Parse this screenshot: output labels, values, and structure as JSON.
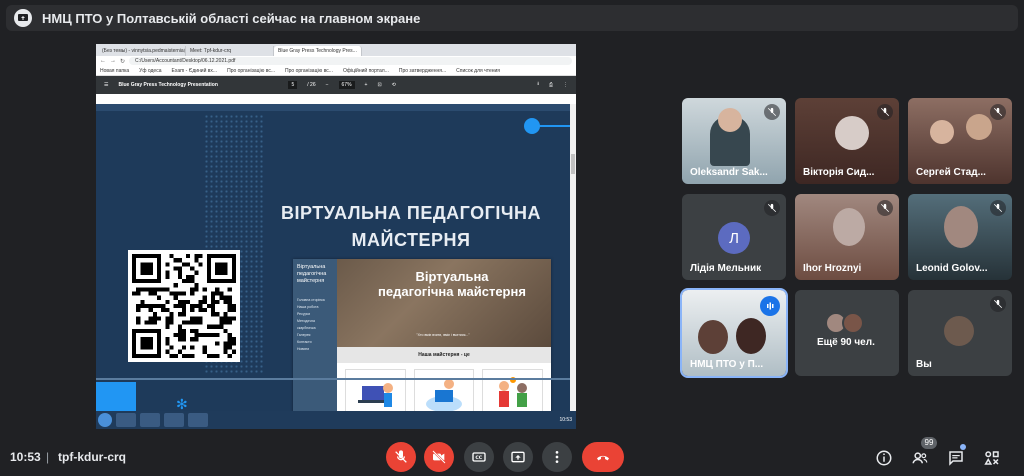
{
  "banner": {
    "text": "НМЦ ПТО у Полтавській області сейчас на главном экране"
  },
  "browser": {
    "tabs": [
      "(Без темы) - vinnytsia.pedmaisternia@...",
      "Meet: Tpf-kdur-crq",
      "Blue Gray Press Technology Pres..."
    ],
    "url": "C:/Users/Accountant/Desktop/06.12.2021.pdf",
    "bookmarks": [
      "Новая папка",
      "Уф одеса",
      "Exam - Єдиний вх...",
      "Про організацію вс...",
      "Про організацію вс...",
      "Офіційний портал...",
      "Про затвердження...",
      "Список для чтения"
    ]
  },
  "pdf": {
    "title": "Blue Gray Press Technology Presentation",
    "page": "5",
    "pages": "/ 26",
    "zoom": "67%"
  },
  "slide": {
    "title": "ВІРТУАЛЬНА ПЕДАГОГІЧНА МАЙСТЕРНЯ",
    "thumb_side_title": "Віртуальна педагогічна майстерня",
    "thumb_side_items": [
      "Головна сторінка",
      "Наша робота",
      "Ресурси",
      "Методична скарбничка",
      "Галерея",
      "Контакти",
      "Новини"
    ],
    "thumb_hero": "Віртуальна педагогічна майстерня",
    "thumb_quote": "\"Хто вміє вчити, вміє і вчитися...\"",
    "thumb_band": "Наша майстерня - це"
  },
  "taskbar": {
    "clock": "10:53"
  },
  "participants": [
    {
      "name": "Oleksandr Sak...",
      "muted": true
    },
    {
      "name": "Вікторія Сид...",
      "muted": true
    },
    {
      "name": "Сергей Стад...",
      "muted": true
    },
    {
      "name": "Лідія Мельник",
      "initial": "Л",
      "muted": true
    },
    {
      "name": "Ihor Hroznyi",
      "muted": true
    },
    {
      "name": "Leonid Golov...",
      "muted": true
    },
    {
      "name": "НМЦ ПТО у П...",
      "speaking": true
    },
    {
      "name": "Ещё 90 чел."
    },
    {
      "name": "Вы",
      "muted": true
    }
  ],
  "bottom": {
    "time": "10:53",
    "separator": "|",
    "meeting_code": "tpf-kdur-crq",
    "people_badge": "99"
  }
}
